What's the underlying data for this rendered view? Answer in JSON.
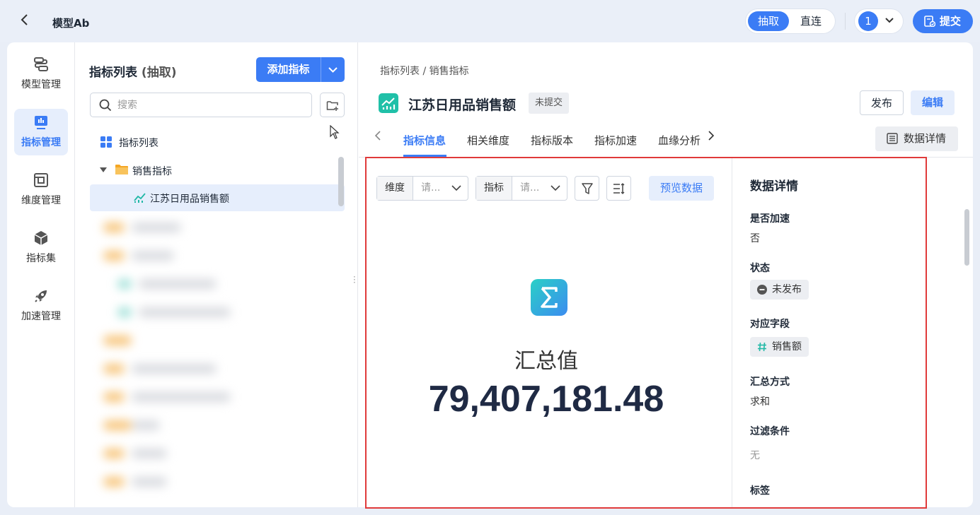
{
  "topbar": {
    "title": "模型Ab",
    "mode_extract": "抽取",
    "mode_direct": "直连",
    "user_number": "1",
    "submit_label": "提交"
  },
  "nav": {
    "items": [
      {
        "label": "模型管理",
        "icon": "model-icon"
      },
      {
        "label": "指标管理",
        "icon": "metric-icon"
      },
      {
        "label": "维度管理",
        "icon": "dimension-icon"
      },
      {
        "label": "指标集",
        "icon": "cube-icon"
      },
      {
        "label": "加速管理",
        "icon": "rocket-icon"
      }
    ],
    "active_index": 1
  },
  "tree": {
    "title": "指标列表",
    "title_suffix": "(抽取)",
    "add_button": "添加指标",
    "search_placeholder": "搜索",
    "rows": [
      {
        "label": "指标列表",
        "icon": "grid-icon"
      },
      {
        "label": "销售指标",
        "icon": "folder-icon"
      },
      {
        "label": "江苏日用品销售额",
        "icon": "chart-icon"
      }
    ]
  },
  "content": {
    "breadcrumb": "指标列表 / 销售指标",
    "metric_title": "江苏日用品销售额",
    "status_tag": "未提交",
    "publish_label": "发布",
    "edit_label": "编辑",
    "tabs": [
      "指标信息",
      "相关维度",
      "指标版本",
      "指标加速",
      "血缘分析"
    ],
    "active_tab": 0,
    "data_details_button": "数据详情"
  },
  "preview": {
    "dimension_label": "维度",
    "dimension_placeholder": "请...",
    "metric_label": "指标",
    "metric_placeholder": "请...",
    "preview_button": "预览数据",
    "summary_label": "汇总值",
    "summary_value": "79,407,181.48"
  },
  "details": {
    "heading": "数据详情",
    "accelerated_label": "是否加速",
    "accelerated_value": "否",
    "status_label": "状态",
    "status_value": "未发布",
    "field_label": "对应字段",
    "field_value": "销售额",
    "agg_label": "汇总方式",
    "agg_value": "求和",
    "filter_label": "过滤条件",
    "filter_value": "无",
    "tags_label": "标签"
  },
  "colors": {
    "accent": "#3b7cf5",
    "highlight_border": "#e03a3a"
  }
}
